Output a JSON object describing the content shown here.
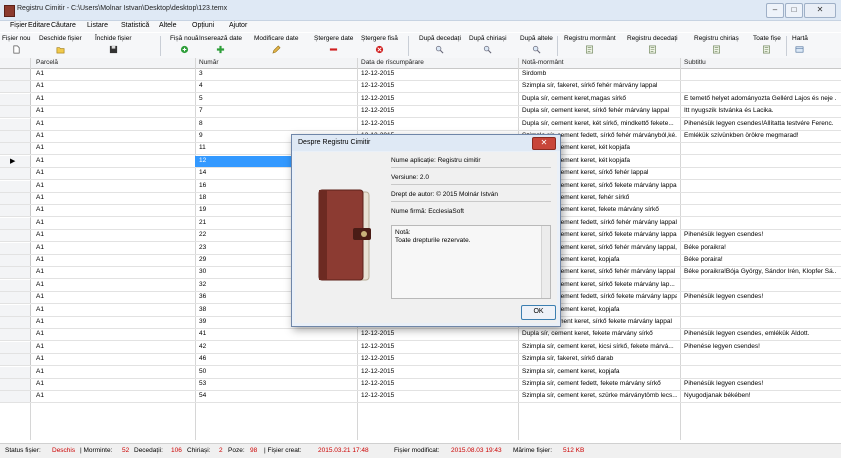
{
  "window": {
    "title": "Registru Cimitir  -  C:\\Users\\Molnar Istvan\\Desktop\\desktop\\123.temx",
    "controls": [
      "minimize-icon",
      "maximize-icon",
      "close-icon"
    ]
  },
  "menu": [
    "Fișier",
    "Editare",
    "Căutare",
    "Listare",
    "Statistică",
    "Altele",
    "Opțiuni",
    "Ajutor"
  ],
  "toolbar": [
    {
      "label": "Fișier nou",
      "icon": "new-file-icon"
    },
    {
      "label": "Deschide fișier",
      "icon": "open-folder-icon"
    },
    {
      "label": "Închide fișier",
      "icon": "save-disk-icon"
    },
    {
      "label": "Fișă nouă",
      "icon": "green-circle-plus-icon"
    },
    {
      "label": "Inserează date",
      "icon": "green-plus-icon"
    },
    {
      "label": "Modificare date",
      "icon": "pencil-icon"
    },
    {
      "label": "Ștergere date",
      "icon": "red-minus-icon"
    },
    {
      "label": "Ștergere fisă",
      "icon": "red-x-circle-icon"
    },
    {
      "label": "După decedați",
      "icon": "magnifier-icon"
    },
    {
      "label": "După chiriași",
      "icon": "magnifier-icon"
    },
    {
      "label": "După altele",
      "icon": "magnifier-icon"
    },
    {
      "label": "Registru mormânt",
      "icon": "register-icon"
    },
    {
      "label": "Registru decedați",
      "icon": "register-icon"
    },
    {
      "label": "Registru chiriaș",
      "icon": "register-icon"
    },
    {
      "label": "Toate fișe",
      "icon": "register-icon"
    },
    {
      "label": "Hartă",
      "icon": "map-icon"
    }
  ],
  "grid": {
    "columns": [
      "Parcelă",
      "Număr",
      "Data de rîscumpărare",
      "Notă-mormânt",
      "Subtitlu"
    ],
    "selected_row_index": 7,
    "rows": [
      [
        "A1",
        "3",
        "12-12-2015",
        "Sirdomb",
        ""
      ],
      [
        "A1",
        "4",
        "12-12-2015",
        "Szimpla sír, fakeret, sírkő fehér márvány lappal",
        ""
      ],
      [
        "A1",
        "5",
        "12-12-2015",
        "Dupla sír, cement keret,magas sírkő",
        "E temető helyet adományozta Gellérd Lajos és neje ..."
      ],
      [
        "A1",
        "7",
        "12-12-2015",
        "Dupla sír, cement keret, sírkő fehér márvány lappal",
        "Itt nyugszik Istvánka és Lacika."
      ],
      [
        "A1",
        "8",
        "12-12-2015",
        "Dupla sír, cement keret, két sírkő, mindkettő fekete...",
        "Pihenésük legyen csendes!Állítatta testvére Ferenc."
      ],
      [
        "A1",
        "9",
        "12-12-2015",
        "Szimpla sír, cement fedett, sírkő fehér márványból,ké...",
        "Emlékük szívünkben örökre megmarad!"
      ],
      [
        "A1",
        "11",
        "12-12-2015",
        "Szimpla sír, cement keret, két kopjafa",
        ""
      ],
      [
        "A1",
        "12",
        "12-12-2015",
        "Szimpla sír, cement keret, két kopjafa",
        ""
      ],
      [
        "A1",
        "14",
        "12-12-2015",
        "Szimpla sír, cement keret, sírkő fehér lappal",
        ""
      ],
      [
        "A1",
        "16",
        "12-12-2015",
        "Szimpla sír, cement keret, sírkő fekete márvány lappal",
        ""
      ],
      [
        "A1",
        "18",
        "12-12-2015",
        "Szimpla sír, cement keret, fehér sírkő",
        ""
      ],
      [
        "A1",
        "19",
        "12-12-2015",
        "Szimpla sír, cement keret, fekete márvány sírkő",
        ""
      ],
      [
        "A1",
        "21",
        "12-12-2015",
        "Szimpla sír, cement fedett, sírkő fehér márvány lappal",
        ""
      ],
      [
        "A1",
        "22",
        "12-12-2015",
        "Szimpla sír, cement keret, sírkő fekete márvány lappal",
        "Pihenésük legyen csendes!"
      ],
      [
        "A1",
        "23",
        "12-12-2015",
        "Szimpla sír, cement keret, sírkő fehér márvány lappal, fény...",
        "Béke poraikra!"
      ],
      [
        "A1",
        "29",
        "12-12-2015",
        "Szimpla sír, cement keret, kopjafa",
        "Béke poraira!"
      ],
      [
        "A1",
        "30",
        "12-12-2015",
        "Szimpla sír, cement keret, sírkő fehér márvány lappal",
        "Béke poraikra!Bója György, Sándor Irén, Klopfer Sá..."
      ],
      [
        "A1",
        "32",
        "12-12-2015",
        "Szimpla sír, cement keret, sírkő fekete márvány lap...",
        ""
      ],
      [
        "A1",
        "36",
        "12-12-2015",
        "Szimpla sír, cement fedett, sírkő fekete márvány lappal",
        "Pihenésük legyen csendes!"
      ],
      [
        "A1",
        "38",
        "12-12-2015",
        "Szimpla sír, cement keret, kopjafa",
        ""
      ],
      [
        "A1",
        "39",
        "12-12-2015",
        "Dupla sír, cement keret, sírkő fekete márvány lappal",
        ""
      ],
      [
        "A1",
        "41",
        "12-12-2015",
        "Dupla sír, cement keret, fekete márvány sírkő",
        "Pihenésük legyen csendes, emlékük Áldott."
      ],
      [
        "A1",
        "42",
        "12-12-2015",
        "Szimpla sír, cement keret, kicsi sírkő, fekete márvá...",
        "Pihenése legyen csendes!"
      ],
      [
        "A1",
        "46",
        "12-12-2015",
        "Szimpla sír, fakeret, sírkő darab",
        ""
      ],
      [
        "A1",
        "50",
        "12-12-2015",
        "Szimpla sír, cement keret, kopjafa",
        ""
      ],
      [
        "A1",
        "53",
        "12-12-2015",
        "Szimpla sír, cement fedett, fekete márvány sírkő",
        "Pihenésük legyen csendes!"
      ],
      [
        "A1",
        "54",
        "12-12-2015",
        "Szimpla sír, cement keret, szürke márványtömb lecs...",
        "Nyugodjanak békében!"
      ]
    ]
  },
  "status": {
    "file_status_label": "Status fișier:",
    "file_status_value": "Deschis",
    "graves_label": "| Morminte:",
    "graves_value": "52",
    "deceased_label": "Decedații:",
    "deceased_value": "106",
    "tenants_label": "Chiriași:",
    "tenants_value": "2",
    "photos_label": "Poze:",
    "photos_value": "98",
    "created_label": "|  Fișier creat:",
    "created_value": "2015.03.21 17:48",
    "modified_label": "Fișier modificat:",
    "modified_value": "2015.08.03 19:43",
    "size_label": "Mărime fișier:",
    "size_value": "512 KB",
    "accent_color": "#cc0000"
  },
  "dialog": {
    "title": "Despre Registru Cimitir",
    "app_name": "Nume aplicație: Registru cimitir",
    "version": "Versiune: 2.0",
    "copyright": "Drept de autor: © 2015 Molnár István",
    "company": "Nume firmă: EcclesiaSoft",
    "notes_label": "Notă:",
    "notes_text": "Toate drepturile rezervate.",
    "ok_label": "OK",
    "close_label": "✕"
  }
}
